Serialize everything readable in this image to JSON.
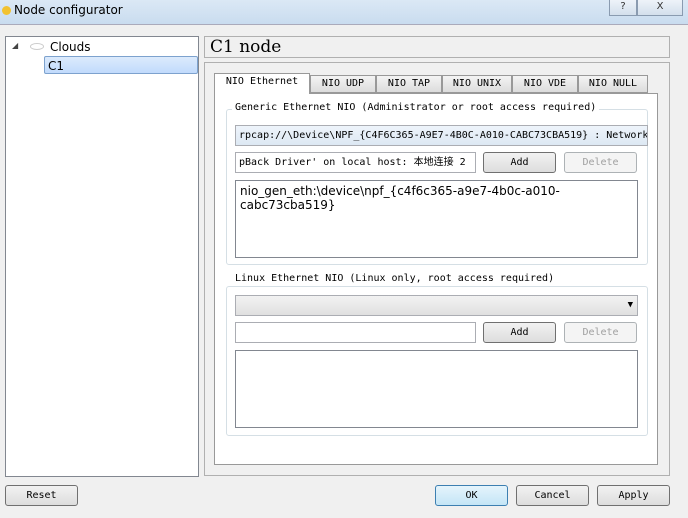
{
  "window": {
    "title": "Node configurator",
    "help": "?",
    "close": "X"
  },
  "tree": {
    "root": "Clouds",
    "items": [
      "C1"
    ]
  },
  "header": {
    "title": "C1 node"
  },
  "tabs": [
    "NIO Ethernet",
    "NIO UDP",
    "NIO TAP",
    "NIO UNIX",
    "NIO VDE",
    "NIO NULL"
  ],
  "generic": {
    "label": "Generic Ethernet NIO (Administrator or root access required)",
    "combo_value": "rpcap://\\Device\\NPF_{C4F6C365-A9E7-4B0C-A010-CABC73CBA519} : Network",
    "input_value": "pBack Driver' on local host: 本地连接 2",
    "add": "Add",
    "delete": "Delete",
    "list": [
      "nio_gen_eth:\\device\\npf_{c4f6c365-a9e7-4b0c-a010-cabc73cba519}"
    ]
  },
  "linux": {
    "label": "Linux Ethernet NIO (Linux only, root access required)",
    "combo_value": "",
    "input_value": "",
    "add": "Add",
    "delete": "Delete"
  },
  "footer": {
    "reset": "Reset",
    "ok": "OK",
    "cancel": "Cancel",
    "apply": "Apply"
  }
}
